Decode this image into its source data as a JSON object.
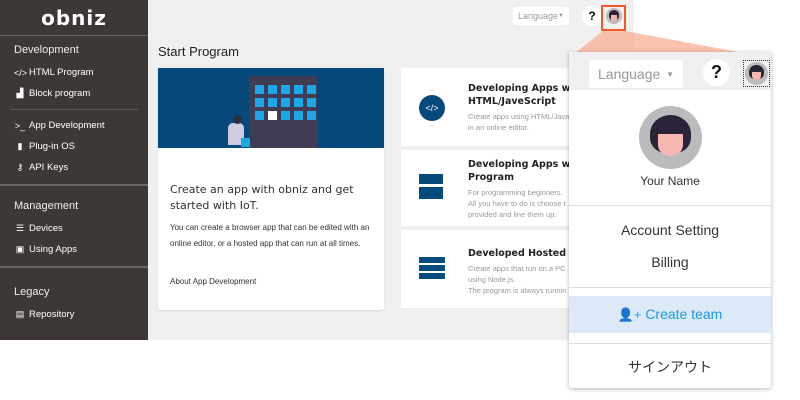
{
  "sidebar": {
    "logo": "obniz",
    "sections": [
      {
        "title": "Development"
      },
      {
        "title": "Management"
      },
      {
        "title": "Legacy"
      }
    ],
    "items": [
      {
        "label": "HTML Program",
        "icon": "code-icon"
      },
      {
        "label": "Block program",
        "icon": "blocks-icon"
      },
      {
        "label": "App Development",
        "icon": "terminal-icon"
      },
      {
        "label": "Plug-in OS",
        "icon": "device-icon"
      },
      {
        "label": "API Keys",
        "icon": "key-icon"
      },
      {
        "label": "Devices",
        "icon": "list-icon"
      },
      {
        "label": "Using Apps",
        "icon": "monitor-icon"
      },
      {
        "label": "Repository",
        "icon": "server-icon"
      }
    ]
  },
  "header": {
    "language": "Language",
    "help": "?"
  },
  "main": {
    "title": "Start Program",
    "intro": {
      "heading": "Create an app with obniz and get started with IoT.",
      "body": "You can create a browser app that can be edited with an online editor, or a hosted app that can run at all times.",
      "link": "About App Development"
    },
    "cards": [
      {
        "title": "Developing Apps wit",
        "title2": "HTML/JaveScript",
        "desc": [
          "Create apps using HTML/Java",
          "in an online editor."
        ]
      },
      {
        "title": "Developing Apps wit",
        "title2": "Program",
        "desc": [
          "For programming beginners.",
          "All you have to do is choose t",
          "provided and line them up."
        ]
      },
      {
        "title": "Developed Hosted Ap",
        "title2": "",
        "desc": [
          "Create apps that run on a PC",
          "using Node.js.",
          "The program is always runnin"
        ]
      }
    ]
  },
  "popup": {
    "language": "Language",
    "help": "?",
    "user_name": "Your Name",
    "account_setting": "Account Setting",
    "billing": "Billing",
    "create_team": "Create team",
    "sign_out": "サインアウト"
  },
  "colors": {
    "sidebar": "#3d3836",
    "brand_blue": "#054a7b",
    "highlight": "#f15a24",
    "create_team": "#1a9be0"
  }
}
